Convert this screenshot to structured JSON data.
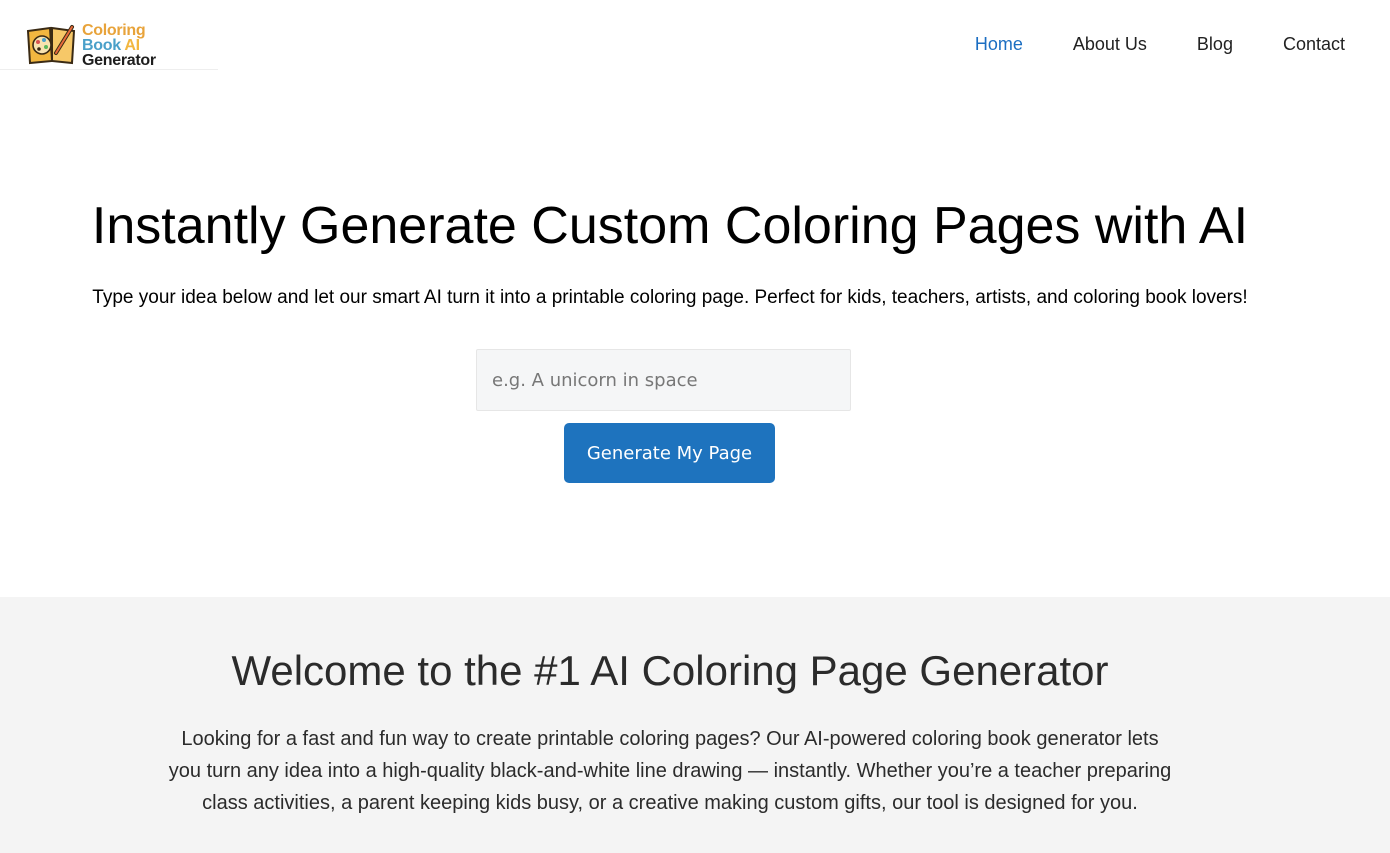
{
  "brand": {
    "logo_line1": "Coloring",
    "logo_line2_word": "Book",
    "logo_line2_ai": "AI",
    "logo_line3": "Generator",
    "colors": {
      "orange": "#e8a33a",
      "blue": "#4aa0c9",
      "dark": "#1e1e1e"
    }
  },
  "nav": {
    "items": [
      {
        "label": "Home",
        "active": true
      },
      {
        "label": "About Us"
      },
      {
        "label": "Blog"
      },
      {
        "label": "Contact"
      }
    ],
    "active_color": "#1b6ec2"
  },
  "hero": {
    "title": "Instantly Generate Custom Coloring Pages with AI",
    "subtitle": "Type your idea below and let our smart AI turn it into a printable coloring page. Perfect for kids, teachers, artists, and coloring book lovers!",
    "input_value": "",
    "input_placeholder": "e.g. A unicorn in space",
    "button_label": "Generate My Page",
    "button_color": "#1e73be"
  },
  "welcome": {
    "title": "Welcome to the #1 AI Coloring Page Generator",
    "text": "Looking for a fast and fun way to create printable coloring pages? Our AI-powered coloring book generator lets you turn any idea into a high-quality black-and-white line drawing — instantly. Whether you’re a teacher preparing class activities, a parent keeping kids busy, or a creative making custom gifts, our tool is designed for you."
  }
}
